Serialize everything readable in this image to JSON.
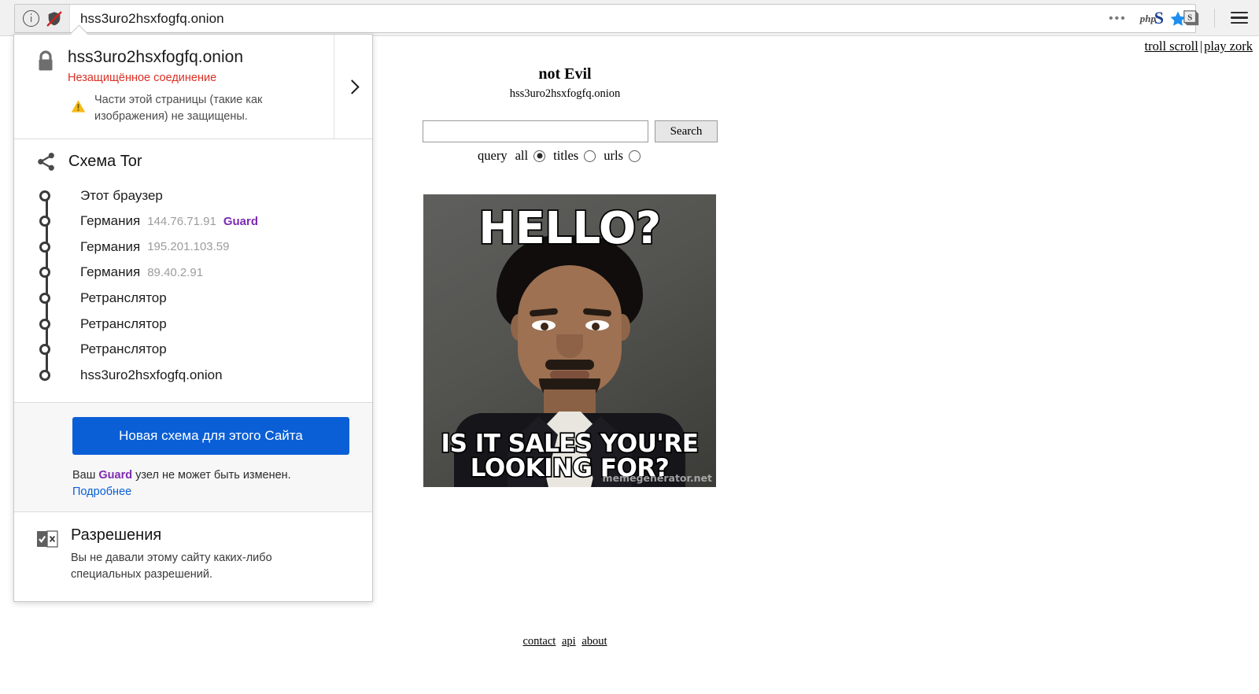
{
  "browser": {
    "url": "hss3uro2hsxfogfq.onion",
    "identity_icon": "info-icon",
    "shield_icon": "broken-shield-icon",
    "toolbar": {
      "overflow_menu": "•••",
      "php_badge": "php",
      "bookmark_icon": "star-icon",
      "ext_blue_s": "S",
      "ext_gray_s": "S",
      "app_menu_icon": "hamburger-icon"
    }
  },
  "identity_panel": {
    "security": {
      "site": "hss3uro2hsxfogfq.onion",
      "connection_status": "Незащищённое соединение",
      "mixed_content_warning": "Части этой страницы (такие как изображения) не защищены."
    },
    "tor": {
      "title": "Схема Tor",
      "nodes": [
        {
          "name": "Этот браузер",
          "ip": "",
          "role": ""
        },
        {
          "name": "Германия",
          "ip": "144.76.71.91",
          "role": "Guard"
        },
        {
          "name": "Германия",
          "ip": "195.201.103.59",
          "role": ""
        },
        {
          "name": "Германия",
          "ip": "89.40.2.91",
          "role": ""
        },
        {
          "name": "Ретранслятор",
          "ip": "",
          "role": ""
        },
        {
          "name": "Ретранслятор",
          "ip": "",
          "role": ""
        },
        {
          "name": "Ретранслятор",
          "ip": "",
          "role": ""
        },
        {
          "name": "hss3uro2hsxfogfq.onion",
          "ip": "",
          "role": ""
        }
      ],
      "new_circuit_button": "Новая схема для этого Сайта",
      "guard_note_before": "Ваш ",
      "guard_note_bold": "Guard",
      "guard_note_after": " узел не может быть изменен.",
      "learn_more": "Подробнее"
    },
    "permissions": {
      "title": "Разрешения",
      "text": "Вы не давали этому сайту каких-либо специальных разрешений."
    }
  },
  "page": {
    "top_links": [
      {
        "label": "troll scroll"
      },
      {
        "label": "play zork"
      }
    ],
    "top_links_separator": "|",
    "brand": "not Evil",
    "brand_subtitle": "hss3uro2hsxfogfq.onion",
    "search": {
      "value": "",
      "placeholder": "",
      "button_label": "Search",
      "query_label": "query",
      "options": [
        {
          "label": "all",
          "selected": true
        },
        {
          "label": "titles",
          "selected": false
        },
        {
          "label": "urls",
          "selected": false
        }
      ]
    },
    "meme": {
      "top_text": "HELLO?",
      "bottom_text": "IS IT SALES YOU'RE LOOKING FOR?",
      "watermark": "memegenerator.net"
    },
    "footer_links": [
      {
        "label": "contact"
      },
      {
        "label": "api"
      },
      {
        "label": "about"
      }
    ]
  },
  "colors": {
    "accent_blue": "#0a5fd6",
    "guard_purple": "#7d2ab3",
    "insecure_red": "#d93025",
    "warning_yellow": "#f5ba1a"
  }
}
